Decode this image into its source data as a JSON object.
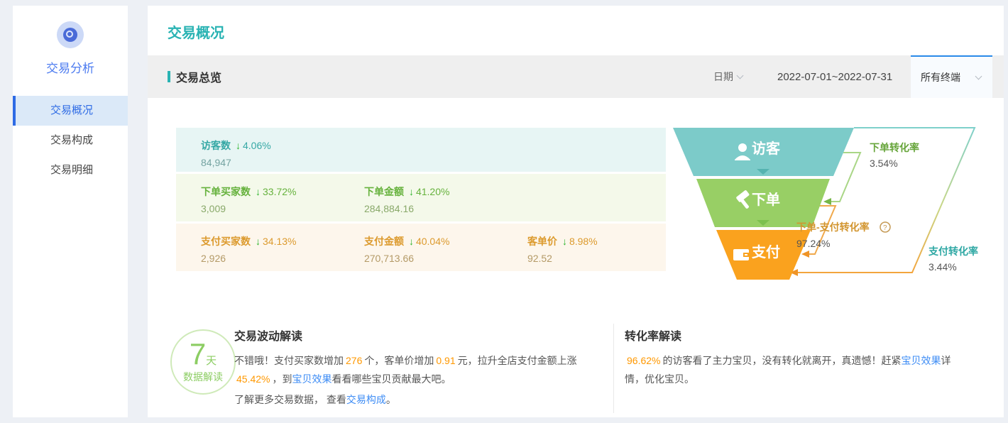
{
  "sidebar": {
    "title": "交易分析",
    "items": [
      {
        "label": "交易概况"
      },
      {
        "label": "交易构成"
      },
      {
        "label": "交易明细"
      }
    ]
  },
  "header": {
    "title": "交易概况"
  },
  "toolbar": {
    "section_title": "交易总览",
    "date_label": "日期",
    "date_range": "2022-07-01~2022-07-31",
    "terminal_selected": "所有终端"
  },
  "metrics": {
    "arrow": "↓",
    "rows": [
      {
        "cells": [
          {
            "label": "访客数",
            "delta": "4.06%",
            "value": "84,947"
          }
        ]
      },
      {
        "cells": [
          {
            "label": "下单买家数",
            "delta": "33.72%",
            "value": "3,009"
          },
          {
            "label": "下单金额",
            "delta": "41.20%",
            "value": "284,884.16"
          }
        ]
      },
      {
        "cells": [
          {
            "label": "支付买家数",
            "delta": "34.13%",
            "value": "2,926"
          },
          {
            "label": "支付金额",
            "delta": "40.04%",
            "value": "270,713.66"
          },
          {
            "label": "客单价",
            "delta": "8.98%",
            "value": "92.52"
          }
        ]
      }
    ]
  },
  "chart_data": {
    "type": "funnel",
    "stages": [
      {
        "label": "访客",
        "color": "#7ccbc9"
      },
      {
        "label": "下单",
        "color": "#98cf65"
      },
      {
        "label": "支付",
        "color": "#faa21e"
      }
    ],
    "rates": [
      {
        "label": "下单转化率",
        "value": "3.54%"
      },
      {
        "label": "下单-支付转化率",
        "value": "97.24%",
        "help_glyph": "?"
      },
      {
        "label": "支付转化率",
        "value": "3.44%"
      }
    ]
  },
  "insight": {
    "badge": {
      "big": "7",
      "unit": "天",
      "caption": "数据解读"
    },
    "left": {
      "title": "交易波动解读",
      "segments": [
        {
          "t": "不错哦！支付买家数增加"
        },
        {
          "t": "276",
          "s": "hl"
        },
        {
          "t": "个，客单价增加"
        },
        {
          "t": "0.91",
          "s": "hl"
        },
        {
          "t": "元，拉升全店支付金额上涨"
        },
        {
          "t": "45.42%",
          "s": "hl"
        },
        {
          "t": "，到"
        },
        {
          "t": "宝贝效果",
          "s": "link"
        },
        {
          "t": "看看哪些宝贝贡献最大吧。"
        }
      ],
      "segments_more": [
        {
          "t": "了解更多交易数据， 查看"
        },
        {
          "t": "交易构成",
          "s": "link"
        },
        {
          "t": "。"
        }
      ]
    },
    "right": {
      "title": "转化率解读",
      "segments": [
        {
          "t": "96.62%",
          "s": "hl"
        },
        {
          "t": "的访客看了主力宝贝，没有转化就离开，真遗憾！赶紧"
        },
        {
          "t": "宝贝效果",
          "s": "link"
        },
        {
          "t": "详情，优化宝贝。"
        }
      ]
    }
  },
  "colors": {
    "accent_teal": "#29b3b3",
    "sidebar_blue": "#4d7cf0",
    "active_item_blue": "#2e6be5",
    "row1_teal": "#35a8a5",
    "row2_green": "#66b23d",
    "row3_orange": "#dc9a2d",
    "arrow_green": "#2db42d",
    "highlight_orange": "#ff9800",
    "link_blue": "#3d8cf5"
  }
}
